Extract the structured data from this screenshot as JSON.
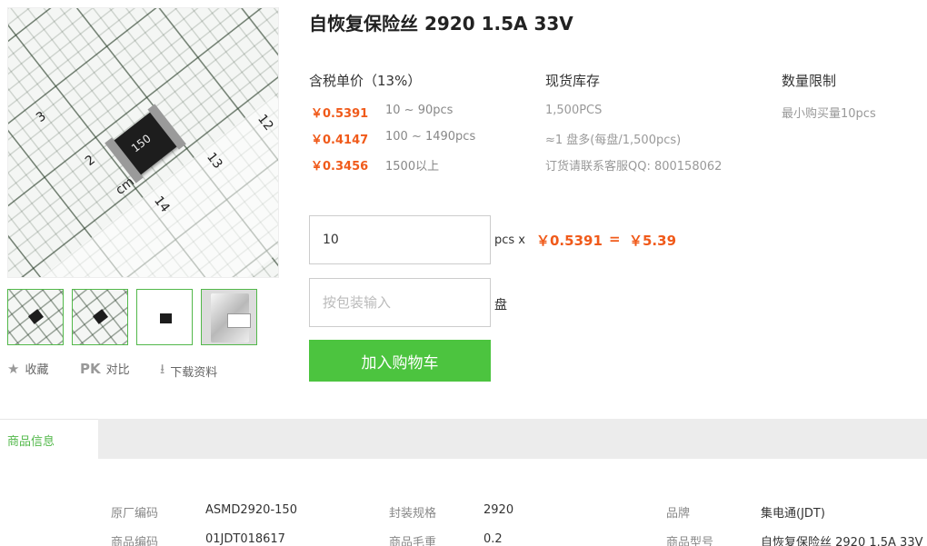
{
  "product": {
    "title": "自恢复保险丝 2920 1.5A 33V",
    "image_chip_label": "150",
    "ruler_numbers": [
      "3",
      "2",
      "cm",
      "14",
      "13",
      "12"
    ]
  },
  "thumbnails": [
    "thumb-1",
    "thumb-2",
    "thumb-3",
    "thumb-4"
  ],
  "actions": {
    "favorite_label": "收藏",
    "compare_prefix": "PK",
    "compare_label": "对比",
    "download_label": "下载资料"
  },
  "pricing": {
    "header": "含税单价（13%）",
    "tiers": [
      {
        "price": "￥0.5391",
        "range": "10 ~ 90pcs"
      },
      {
        "price": "￥0.4147",
        "range": "100 ~ 1490pcs"
      },
      {
        "price": "￥0.3456",
        "range": "1500以上"
      }
    ]
  },
  "stock": {
    "header": "现货库存",
    "lines": [
      "1,500PCS",
      "≈1 盘多(每盘/1,500pcs)",
      "订货请联系客服QQ: 800158062"
    ]
  },
  "limit": {
    "header": "数量限制",
    "text": "最小购买量10pcs"
  },
  "order": {
    "quantity_value": "10",
    "quantity_unit": "pcs x",
    "unit_price": "￥0.5391",
    "equals": "=",
    "total": "￥5.39",
    "pack_placeholder": "按包装输入",
    "pack_unit": "盘",
    "add_to_cart": "加入购物车"
  },
  "tabs": {
    "active": "商品信息"
  },
  "specs": [
    {
      "label": "原厂编码",
      "value": "ASMD2920-150"
    },
    {
      "label": "封装规格",
      "value": "2920"
    },
    {
      "label": "品牌",
      "value": "集电通(JDT)"
    },
    {
      "label": "商品编码",
      "value": "01JDT018617"
    },
    {
      "label": "商品毛重",
      "value": "0.2"
    },
    {
      "label": "商品型号",
      "value": "自恢复保险丝 2920 1.5A 33V"
    }
  ],
  "colors": {
    "accent_green": "#4cc43f",
    "price_orange": "#f05a1a"
  }
}
